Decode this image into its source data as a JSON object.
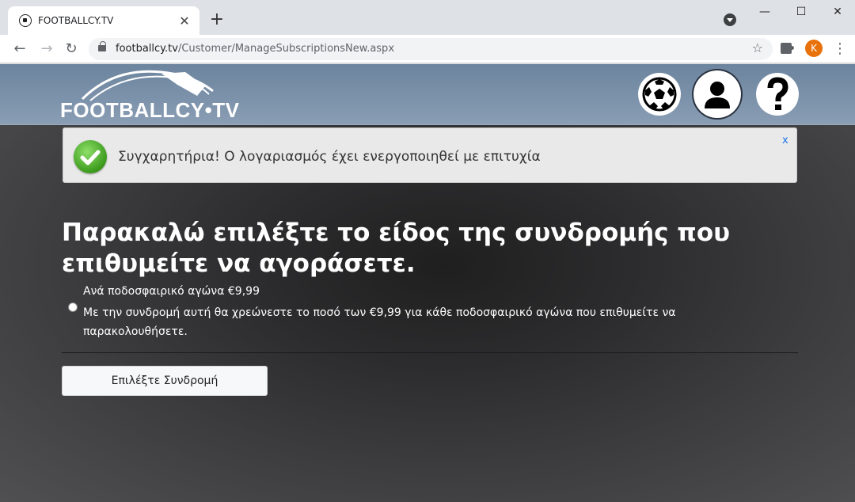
{
  "browser": {
    "tab_title": "FOOTBALLCY.TV",
    "tab_close": "✕",
    "new_tab": "+",
    "url_host": "footballcy.tv",
    "url_path": "/Customer/ManageSubscriptionsNew.aspx",
    "profile_initial": "K",
    "window": {
      "minimize": "—",
      "maximize": "☐",
      "close": "✕"
    },
    "nav": {
      "back": "←",
      "forward": "→",
      "reload": "↻"
    },
    "star": "☆",
    "menu": "⋮"
  },
  "site": {
    "logo_text": "FOOTBALLCY•TV",
    "header_icons": [
      "soccer-ball-icon",
      "user-profile-icon",
      "help-question-icon"
    ]
  },
  "alert": {
    "message": "Συγχαρητήρια! Ο λογαριασμός έχει ενεργοποιηθεί με επιτυχία",
    "close_label": "x"
  },
  "main": {
    "heading": "Παρακαλώ επιλέξτε το είδος της συνδρομής που επιθυμείτε να αγοράσετε.",
    "option": {
      "title": "Ανά ποδοσφαιρικό αγώνα €9,99",
      "description": "Με την συνδρομή αυτή θα χρεώνεστε το ποσό των €9,99 για κάθε ποδοσφαιρικό αγώνα που επιθυμείτε να παρακολουθήσετε.",
      "selected": false
    },
    "select_button": "Επιλέξτε Συνδρομή"
  },
  "colors": {
    "header_bg": "#7d93ab",
    "alert_bg": "#e9e9e9",
    "success_green": "#3b9a1c",
    "profile_orange": "#e8710a"
  }
}
